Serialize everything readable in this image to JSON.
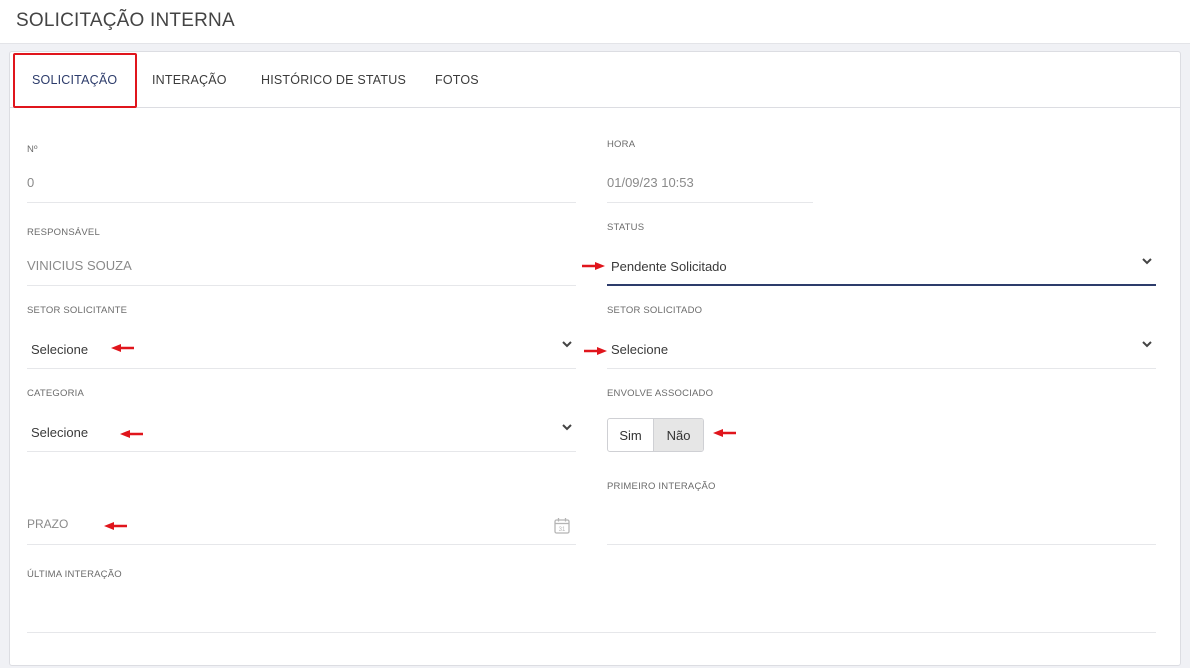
{
  "page": {
    "title": "SOLICITAÇÃO INTERNA"
  },
  "tabs": [
    {
      "label": "SOLICITAÇÃO",
      "active": true
    },
    {
      "label": "INTERAÇÃO",
      "active": false
    },
    {
      "label": "HISTÓRICO DE STATUS",
      "active": false
    },
    {
      "label": "FOTOS",
      "active": false
    }
  ],
  "form": {
    "numero": {
      "label": "Nº",
      "value": "0"
    },
    "hora": {
      "label": "HORA",
      "value": "01/09/23 10:53"
    },
    "responsavel": {
      "label": "RESPONSÁVEL",
      "value": "VINICIUS SOUZA"
    },
    "status": {
      "label": "STATUS",
      "value": "Pendente Solicitado"
    },
    "setor_solicitante": {
      "label": "SETOR SOLICITANTE",
      "value": "Selecione"
    },
    "setor_solicitado": {
      "label": "SETOR SOLICITADO",
      "value": "Selecione"
    },
    "categoria": {
      "label": "CATEGORIA",
      "value": "Selecione"
    },
    "envolve_associado": {
      "label": "ENVOLVE ASSOCIADO",
      "options": [
        "Sim",
        "Não"
      ],
      "selected": "Não"
    },
    "prazo": {
      "placeholder": "PRAZO",
      "icon": "calendar-icon"
    },
    "primeiro_interacao": {
      "label": "PRIMEIRO INTERAÇÃO",
      "value": ""
    },
    "ultima_interacao": {
      "label": "ÚLTIMA INTERAÇÃO",
      "value": ""
    }
  },
  "colors": {
    "accent": "#2d3c6b",
    "annotation": "#e0151c",
    "selected_toggle": "#e6e6e6"
  }
}
